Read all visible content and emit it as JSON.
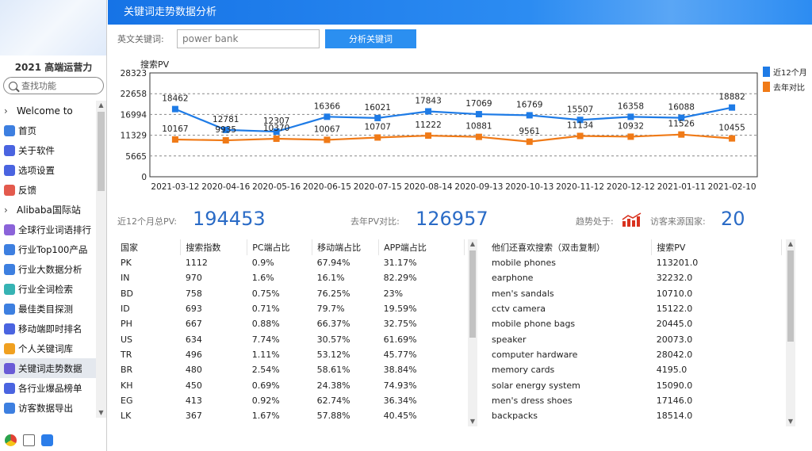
{
  "sidebar": {
    "brand": "2021 高端运营力",
    "search_placeholder": "查找功能",
    "items": [
      {
        "label": "Welcome to",
        "type": "group"
      },
      {
        "label": "首页",
        "color": "#3d7fe0"
      },
      {
        "label": "关于软件",
        "color": "#4a64e0"
      },
      {
        "label": "选项设置",
        "color": "#4a64e0"
      },
      {
        "label": "反馈",
        "color": "#e35a4d"
      },
      {
        "label": "Alibaba国际站",
        "type": "group"
      },
      {
        "label": "全球行业词语排行",
        "color": "#8b63d9"
      },
      {
        "label": "行业Top100产品",
        "color": "#3d7fe0"
      },
      {
        "label": "行业大数据分析",
        "color": "#3d7fe0"
      },
      {
        "label": "行业全词检索",
        "color": "#36b3b3"
      },
      {
        "label": "最佳类目探测",
        "color": "#3d7fe0"
      },
      {
        "label": "移动端即时排名",
        "color": "#4a64e0"
      },
      {
        "label": "个人关键词库",
        "color": "#f0a020"
      },
      {
        "label": "关键词走势数据",
        "color": "#6a5bd6",
        "active": true
      },
      {
        "label": "各行业爆品榜单",
        "color": "#4a64e0"
      },
      {
        "label": "访客数据导出",
        "color": "#3d7fe0"
      }
    ]
  },
  "header": {
    "title": "关键词走势数据分析"
  },
  "keyword": {
    "label": "英文关键词:",
    "value": "power bank",
    "button": "分析关键词"
  },
  "chart_data": {
    "type": "line",
    "ylabel": "搜索PV",
    "categories": [
      "2021-03-12",
      "2020-04-16",
      "2020-05-16",
      "2020-06-15",
      "2020-07-15",
      "2020-08-14",
      "2020-09-13",
      "2020-10-13",
      "2020-11-12",
      "2020-12-12",
      "2021-01-11",
      "2021-02-10"
    ],
    "yticks": [
      0,
      5665,
      11329,
      16994,
      22658,
      28323
    ],
    "ylim": [
      0,
      28323
    ],
    "grid": true,
    "legend_position": "right",
    "series": [
      {
        "name": "近12个月",
        "color": "#1e7be6",
        "values": [
          18462,
          12781,
          12307,
          16366,
          16021,
          17843,
          17069,
          16769,
          15507,
          16358,
          16088,
          18882
        ]
      },
      {
        "name": "去年对比",
        "color": "#f07a17",
        "values": [
          10167,
          9935,
          10370,
          10067,
          10707,
          11222,
          10881,
          9561,
          11134,
          10932,
          11526,
          10455
        ]
      }
    ]
  },
  "stats": {
    "total_label": "近12个月总PV:",
    "total_value": "194453",
    "last_label": "去年PV对比:",
    "last_value": "126957",
    "trend_label": "趋势处于:",
    "country_label": "访客来源国家:",
    "country_value": "20"
  },
  "country_table": {
    "headers": [
      "国家",
      "搜索指数",
      "PC端占比",
      "移动端占比",
      "APP端占比"
    ],
    "rows": [
      [
        "PK",
        "1112",
        "0.9%",
        "67.94%",
        "31.17%"
      ],
      [
        "IN",
        "970",
        "1.6%",
        "16.1%",
        "82.29%"
      ],
      [
        "BD",
        "758",
        "0.75%",
        "76.25%",
        "23%"
      ],
      [
        "ID",
        "693",
        "0.71%",
        "79.7%",
        "19.59%"
      ],
      [
        "PH",
        "667",
        "0.88%",
        "66.37%",
        "32.75%"
      ],
      [
        "US",
        "634",
        "7.74%",
        "30.57%",
        "61.69%"
      ],
      [
        "TR",
        "496",
        "1.11%",
        "53.12%",
        "45.77%"
      ],
      [
        "BR",
        "480",
        "2.54%",
        "58.61%",
        "38.84%"
      ],
      [
        "KH",
        "450",
        "0.69%",
        "24.38%",
        "74.93%"
      ],
      [
        "EG",
        "413",
        "0.92%",
        "62.74%",
        "36.34%"
      ],
      [
        "LK",
        "367",
        "1.67%",
        "57.88%",
        "40.45%"
      ]
    ]
  },
  "related_table": {
    "headers": [
      "他们还喜欢搜索（双击复制）",
      "搜索PV"
    ],
    "rows": [
      [
        "mobile phones",
        "113201.0"
      ],
      [
        "earphone",
        "32232.0"
      ],
      [
        "men's sandals",
        "10710.0"
      ],
      [
        "cctv camera",
        "15122.0"
      ],
      [
        "mobile phone bags",
        "20445.0"
      ],
      [
        "speaker",
        "20073.0"
      ],
      [
        "computer hardware",
        "28042.0"
      ],
      [
        "memory cards",
        "4195.0"
      ],
      [
        "solar energy system",
        "15090.0"
      ],
      [
        "men's dress shoes",
        "17146.0"
      ],
      [
        "backpacks",
        "18514.0"
      ]
    ]
  }
}
